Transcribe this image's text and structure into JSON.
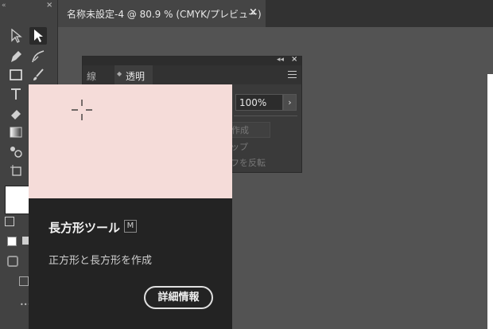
{
  "document": {
    "tab_title": "名称未設定-4 @ 80.9 % (CMYK/プレビュー)",
    "close_glyph": "×"
  },
  "toolbar": {
    "collapse_glyph": "«",
    "close_glyph": "×",
    "tools": [
      {
        "name": "selection-tool-icon",
        "selected": false
      },
      {
        "name": "direct-selection-tool-icon",
        "selected": true
      },
      {
        "name": "pen-tool-icon",
        "selected": false
      },
      {
        "name": "curvature-tool-icon",
        "selected": false
      },
      {
        "name": "rectangle-tool-icon",
        "selected": false
      },
      {
        "name": "paintbrush-tool-icon",
        "selected": false
      },
      {
        "name": "type-tool-icon",
        "selected": false
      },
      {
        "name": "eraser-tool-icon",
        "selected": false
      },
      {
        "name": "gradient-tool-icon",
        "selected": false
      },
      {
        "name": "blend-tool-icon",
        "selected": false
      },
      {
        "name": "artboard-tool-icon",
        "selected": false
      }
    ],
    "more_tools_glyph": "•••"
  },
  "panel": {
    "collapse_glyph": "◂◂",
    "close_glyph": "×",
    "tab_stroke": "線",
    "tab_transparency": "透明",
    "tab_arrows": "◆",
    "opacity_value": "100%",
    "opacity_arrow": "›",
    "ghost_text": [
      "作成",
      "ップ",
      "フを反転"
    ]
  },
  "tooltip": {
    "title": "長方形ツール",
    "shortcut": "M",
    "description": "正方形と長方形を作成",
    "more_info_label": "詳細情報",
    "preview_color": "#f5dcd9"
  },
  "colors": {
    "workspace": "#535353",
    "toolbar": "#424242",
    "tooltip_bg": "#232323"
  }
}
